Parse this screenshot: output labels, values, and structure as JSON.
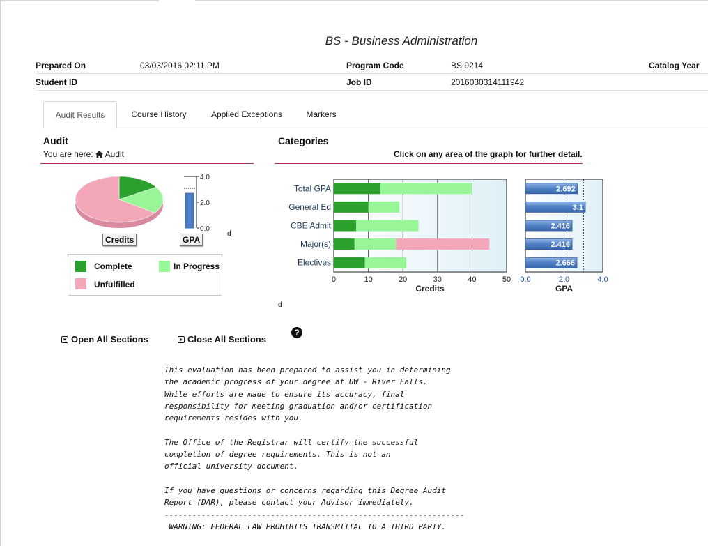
{
  "page": {
    "title": "BS - Business Administration"
  },
  "info": {
    "prepared_on_label": "Prepared On",
    "prepared_on": "03/03/2016 02:11 PM",
    "program_code_label": "Program Code",
    "program_code": "BS 9214",
    "catalog_year_label": "Catalog Year",
    "student_id_label": "Student ID",
    "job_id_label": "Job ID",
    "job_id": "201603031411194​2"
  },
  "tabs": [
    {
      "label": "Audit Results",
      "active": true
    },
    {
      "label": "Course History",
      "active": false
    },
    {
      "label": "Applied Exceptions",
      "active": false
    },
    {
      "label": "Markers",
      "active": false
    }
  ],
  "audit": {
    "heading": "Audit",
    "you_are_here": "You are here:",
    "crumb": "Audit",
    "credits_button": "Credits",
    "gpa_button": "GPA",
    "stray_d": "d",
    "pie": {
      "complete": 0.16,
      "in_progress": 0.19,
      "unfulfilled": 0.65
    },
    "gpa_bar": {
      "value": 2.7,
      "ticks": [
        "4.0",
        "2.0",
        "0.0"
      ],
      "max": 4.0
    },
    "legend": {
      "complete": "Complete",
      "in_progress": "In Progress",
      "unfulfilled": "Unfulfilled"
    }
  },
  "categories": {
    "heading": "Categories",
    "instruction": "Click on any area of the graph for further detail.",
    "stray_d": "d"
  },
  "colors": {
    "complete": "#2ca02c",
    "in_progress": "#98f598",
    "unfulfilled": "#f4a7b9",
    "gpa_bar": "#4f7fc4",
    "accent_line": "#b5304a"
  },
  "chart_data": [
    {
      "type": "bar",
      "orientation": "horizontal",
      "stacked": true,
      "categories": [
        "Total GPA",
        "General Ed",
        "CBE Admit",
        "Major(s)",
        "Electives"
      ],
      "series": [
        {
          "name": "Complete",
          "values": [
            13.5,
            10,
            6.5,
            6,
            9
          ]
        },
        {
          "name": "In Progress",
          "values": [
            26.5,
            9,
            18,
            12,
            12
          ]
        },
        {
          "name": "Unfulfilled",
          "values": [
            0,
            0,
            0,
            27,
            0
          ]
        }
      ],
      "xlabel": "Credits",
      "xlim": [
        0,
        50
      ],
      "xticks": [
        "0",
        "10",
        "20",
        "30",
        "40",
        "50"
      ]
    },
    {
      "type": "bar",
      "orientation": "horizontal",
      "categories": [
        "Total GPA",
        "General Ed",
        "CBE Admit",
        "Major(s)",
        "Electives"
      ],
      "values": [
        2.692,
        3.1,
        2.416,
        2.416,
        2.666
      ],
      "labels": [
        "2.692",
        "3.1",
        "2.416",
        "2.416",
        "2.666"
      ],
      "xlabel": "GPA",
      "xlim": [
        0,
        4
      ],
      "xticks": [
        "0.0",
        "2.0",
        "4.0"
      ]
    }
  ],
  "sections": {
    "open_all": "Open All Sections",
    "close_all": "Close All Sections",
    "help": "?"
  },
  "disclaimer": {
    "lines": [
      "This evaluation has been prepared to assist you in determining",
      "the academic progress of your degree at UW - River Falls.",
      "While efforts are made to ensure its accuracy, final",
      "responsibility for meeting graduation and/or certification",
      "requirements resides with you.",
      "",
      "The Office of the Registrar will certify the successful",
      "completion of degree requirements. This is not an",
      "official university document.",
      "",
      "If you have questions or concerns regarding this Degree Audit",
      "Report (DAR), please contact your Advisor immediately.",
      "-----------------------------------------------------------------",
      " WARNING: FEDERAL LAW PROHIBITS TRANSMITTAL TO A THIRD PARTY."
    ]
  }
}
